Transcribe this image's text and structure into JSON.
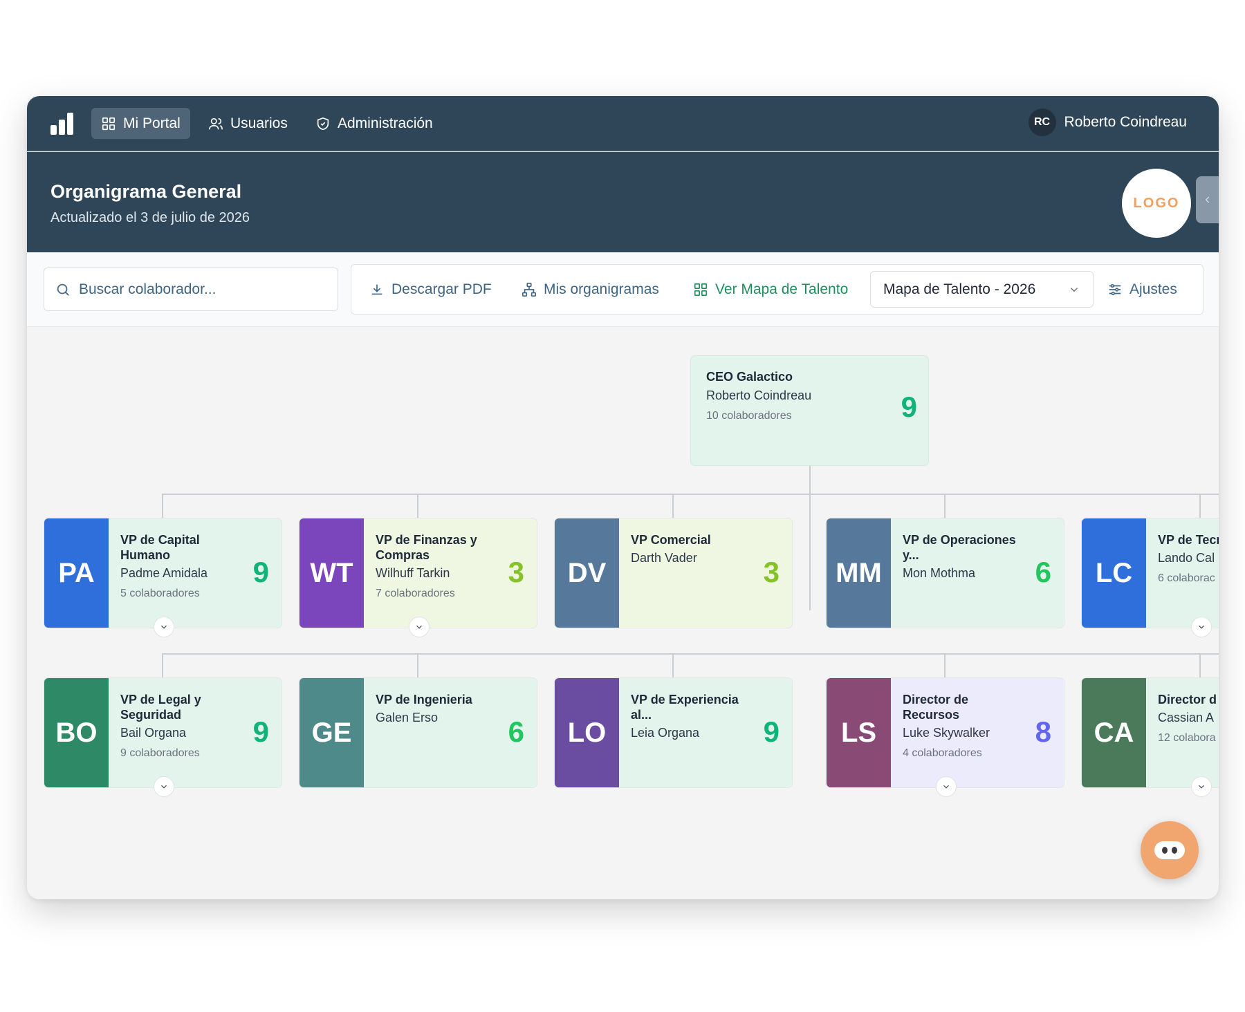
{
  "nav": {
    "items": [
      {
        "label": "Mi Portal",
        "icon": "grid-icon",
        "active": true
      },
      {
        "label": "Usuarios",
        "icon": "users-icon",
        "active": false
      },
      {
        "label": "Administración",
        "icon": "shield-icon",
        "active": false
      }
    ],
    "user": {
      "initials": "RC",
      "name": "Roberto Coindreau"
    }
  },
  "header": {
    "title": "Organigrama General",
    "subtitle": "Actualizado el 3 de julio de 2026",
    "logo_text": "LOGO"
  },
  "toolbar": {
    "search_placeholder": "Buscar colaborador...",
    "download_label": "Descargar PDF",
    "my_charts_label": "Mis organigramas",
    "talent_map_label": "Ver Mapa de Talento",
    "select_value": "Mapa de Talento - 2026",
    "settings_label": "Ajustes"
  },
  "ceo": {
    "role": "CEO Galactico",
    "name": "Roberto Coindreau",
    "count": "10 colaboradores",
    "score": "9",
    "score_color": "#10b47a"
  },
  "row1": [
    {
      "initials": "PA",
      "role": "VP de Capital Humano",
      "name": "Padme Amidala",
      "count": "5 colaboradores",
      "score": "9",
      "avatar_color": "#2f6fdc",
      "bg": "#e3f4ec",
      "score_color": "#10b47a",
      "expand": true
    },
    {
      "initials": "WT",
      "role": "VP de Finanzas y Compras",
      "name": "Wilhuff Tarkin",
      "count": "7 colaboradores",
      "score": "3",
      "avatar_color": "#7b45bb",
      "bg": "#eff7e2",
      "score_color": "#84c225",
      "expand": true
    },
    {
      "initials": "DV",
      "role": "VP Comercial",
      "name": "Darth Vader",
      "count": "",
      "score": "3",
      "avatar_color": "#56789a",
      "bg": "#eff7e2",
      "score_color": "#84c225",
      "expand": false
    },
    {
      "initials": "MM",
      "role": "VP de Operaciones y...",
      "name": "Mon Mothma",
      "count": "",
      "score": "6",
      "avatar_color": "#56789a",
      "bg": "#e3f4ec",
      "score_color": "#22c55e",
      "expand": false
    },
    {
      "initials": "LC",
      "role": "VP de Tecnologi",
      "name": "Lando Cal",
      "count": "6 colaborac",
      "score": "",
      "avatar_color": "#2f6fdc",
      "bg": "#e3f4ec",
      "score_color": "#10b47a",
      "expand": true
    }
  ],
  "row2": [
    {
      "initials": "BO",
      "role": "VP de Legal y Seguridad",
      "name": "Bail Organa",
      "count": "9 colaboradores",
      "score": "9",
      "avatar_color": "#2e8a66",
      "bg": "#e3f4ec",
      "score_color": "#10b47a",
      "expand": true
    },
    {
      "initials": "GE",
      "role": "VP de Ingenieria",
      "name": "Galen Erso",
      "count": "",
      "score": "6",
      "avatar_color": "#4f8a8a",
      "bg": "#e3f4ec",
      "score_color": "#22c55e",
      "expand": false
    },
    {
      "initials": "LO",
      "role": "VP de Experiencia al...",
      "name": "Leia Organa",
      "count": "",
      "score": "9",
      "avatar_color": "#6a4da0",
      "bg": "#e3f4ec",
      "score_color": "#10b47a",
      "expand": false
    },
    {
      "initials": "LS",
      "role": "Director de Recursos",
      "name": "Luke Skywalker",
      "count": "4 colaboradores",
      "score": "8",
      "avatar_color": "#8a4a76",
      "bg": "#ecebfb",
      "score_color": "#6366f1",
      "expand": true
    },
    {
      "initials": "CA",
      "role": "Director d Servicios",
      "name": "Cassian A",
      "count": "12 colabora",
      "score": "",
      "avatar_color": "#4a7a5a",
      "bg": "#e3f4ec",
      "score_color": "#10b47a",
      "expand": true
    }
  ]
}
